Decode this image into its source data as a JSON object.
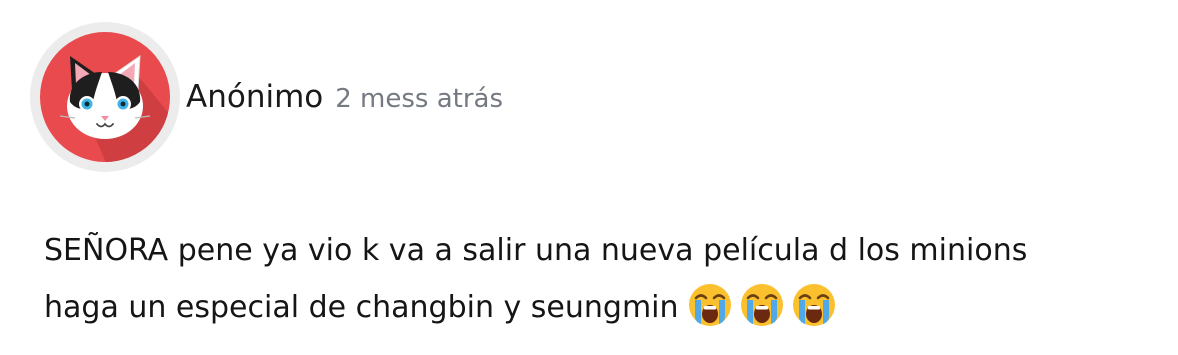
{
  "comment": {
    "author": "Anónimo",
    "time": "2 mess atrás",
    "avatar_icon": "cat-avatar-icon",
    "avatar_color": "#e84a4d",
    "body_lines": [
      "SEÑORA pene ya vio k va a salir una nueva película d los minions",
      "haga un especial de changbin y seungmin"
    ],
    "emojis": [
      "loudly-crying-face-icon",
      "loudly-crying-face-icon",
      "loudly-crying-face-icon"
    ]
  }
}
